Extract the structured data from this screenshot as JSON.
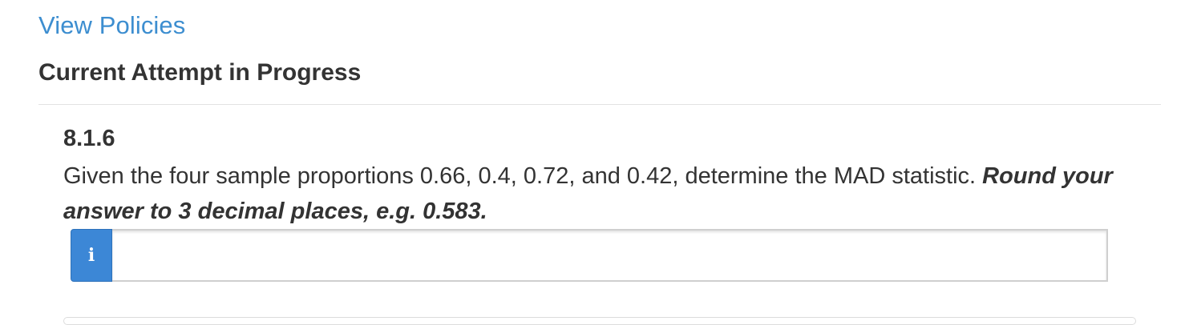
{
  "links": {
    "view_policies": "View Policies"
  },
  "attempt": {
    "heading": "Current Attempt in Progress"
  },
  "question": {
    "number": "8.1.6",
    "prompt": "Given the four sample proportions 0.66, 0.4, 0.72, and 0.42, determine the MAD statistic. ",
    "instruction": "Round your answer to 3 decimal places, e.g. 0.583."
  },
  "answer": {
    "info_glyph": "i",
    "info_icon": "info-icon",
    "value": "",
    "accent_color": "#3c87d6"
  }
}
